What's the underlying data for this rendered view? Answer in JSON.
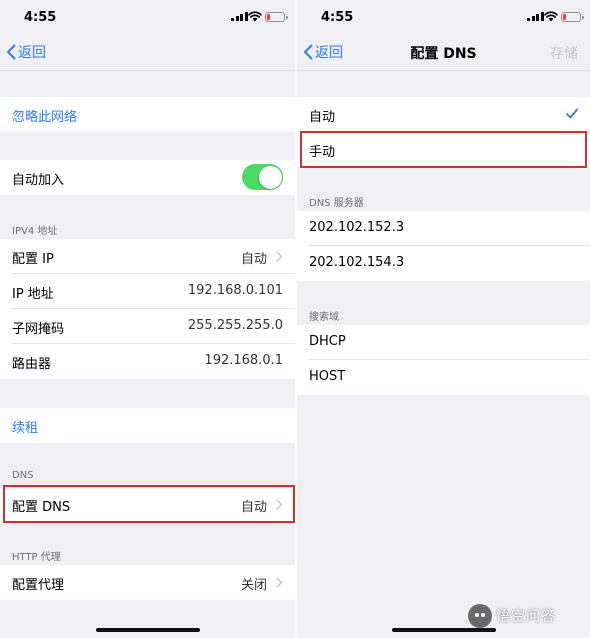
{
  "left": {
    "status": {
      "time": "4:55"
    },
    "nav": {
      "back_label": "返回"
    },
    "forget_network": "忽略此网络",
    "auto_join": {
      "label": "自动加入",
      "enabled": true
    },
    "ipv4": {
      "header": "IPV4 地址",
      "rows": [
        {
          "label": "配置 IP",
          "value": "自动"
        },
        {
          "label": "IP 地址",
          "value": "192.168.0.101"
        },
        {
          "label": "子网掩码",
          "value": "255.255.255.0"
        },
        {
          "label": "路由器",
          "value": "192.168.0.1"
        }
      ]
    },
    "renew_lease": "续租",
    "dns": {
      "header": "DNS",
      "configure_label": "配置 DNS",
      "configure_value": "自动"
    },
    "http_proxy": {
      "header": "HTTP 代理",
      "configure_label": "配置代理",
      "configure_value": "关闭"
    }
  },
  "right": {
    "status": {
      "time": "4:55"
    },
    "nav": {
      "back_label": "返回",
      "title": "配置 DNS",
      "save_label": "存储"
    },
    "modes": [
      {
        "label": "自动",
        "selected": true
      },
      {
        "label": "手动",
        "selected": false
      }
    ],
    "dns_servers": {
      "header": "DNS 服务器",
      "items": [
        "202.102.152.3",
        "202.102.154.3"
      ]
    },
    "search_domains": {
      "header": "搜索域",
      "items": [
        "DHCP",
        "HOST"
      ]
    }
  },
  "watermark": {
    "text": "悟空问答"
  },
  "colors": {
    "accent": "#2f7bef",
    "toggle_on": "#4cd964",
    "highlight": "#d0302f",
    "background": "#efeff4"
  }
}
